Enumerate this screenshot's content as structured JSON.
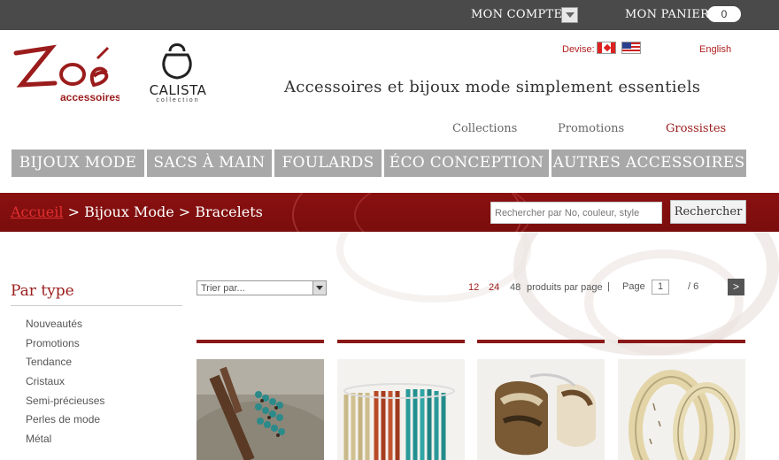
{
  "topbar": {
    "account_label": "MON COMPTE",
    "cart_label": "MON PANIER",
    "cart_count": "0"
  },
  "brand": {
    "logo_text": "Zoé",
    "logo_subtext": "accessoires",
    "calista_name": "CALISTA",
    "calista_sub": "collection",
    "tagline": "Accessoires et bijoux mode simplement essentiels"
  },
  "header": {
    "currency_label": "Devise:",
    "language_link": "English",
    "links": [
      {
        "label": "Collections"
      },
      {
        "label": "Promotions"
      },
      {
        "label": "Grossistes"
      }
    ]
  },
  "nav": {
    "items": [
      {
        "label": "BIJOUX MODE"
      },
      {
        "label": "SACS À MAIN"
      },
      {
        "label": "FOULARDS"
      },
      {
        "label": "ÉCO CONCEPTION"
      },
      {
        "label": "AUTRES ACCESSOIRES"
      }
    ]
  },
  "breadcrumb": {
    "home": "Accueil",
    "rest": " > Bijoux Mode > Bracelets"
  },
  "search": {
    "placeholder": "Rechercher par No, couleur, style",
    "button_label": "Rechercher"
  },
  "sidebar": {
    "title": "Par type",
    "items": [
      {
        "label": "Nouveautés"
      },
      {
        "label": "Promotions"
      },
      {
        "label": "Tendance"
      },
      {
        "label": "Cristaux"
      },
      {
        "label": "Semi-précieuses"
      },
      {
        "label": "Perles de mode"
      },
      {
        "label": "Métal"
      }
    ]
  },
  "toolbar": {
    "sort_value": "Trier par...",
    "per_page_options": [
      "12",
      "24",
      "48"
    ],
    "per_page_label": "produits par page",
    "separator": "|",
    "page_label": "Page",
    "page_value": "1",
    "page_total": "/ 6",
    "next_label": ">"
  },
  "colors": {
    "accent": "#9b1c1c",
    "banner": "#7a0d0d",
    "nav_bg": "#a8a8a8",
    "topbar_bg": "#4a4a4a"
  }
}
